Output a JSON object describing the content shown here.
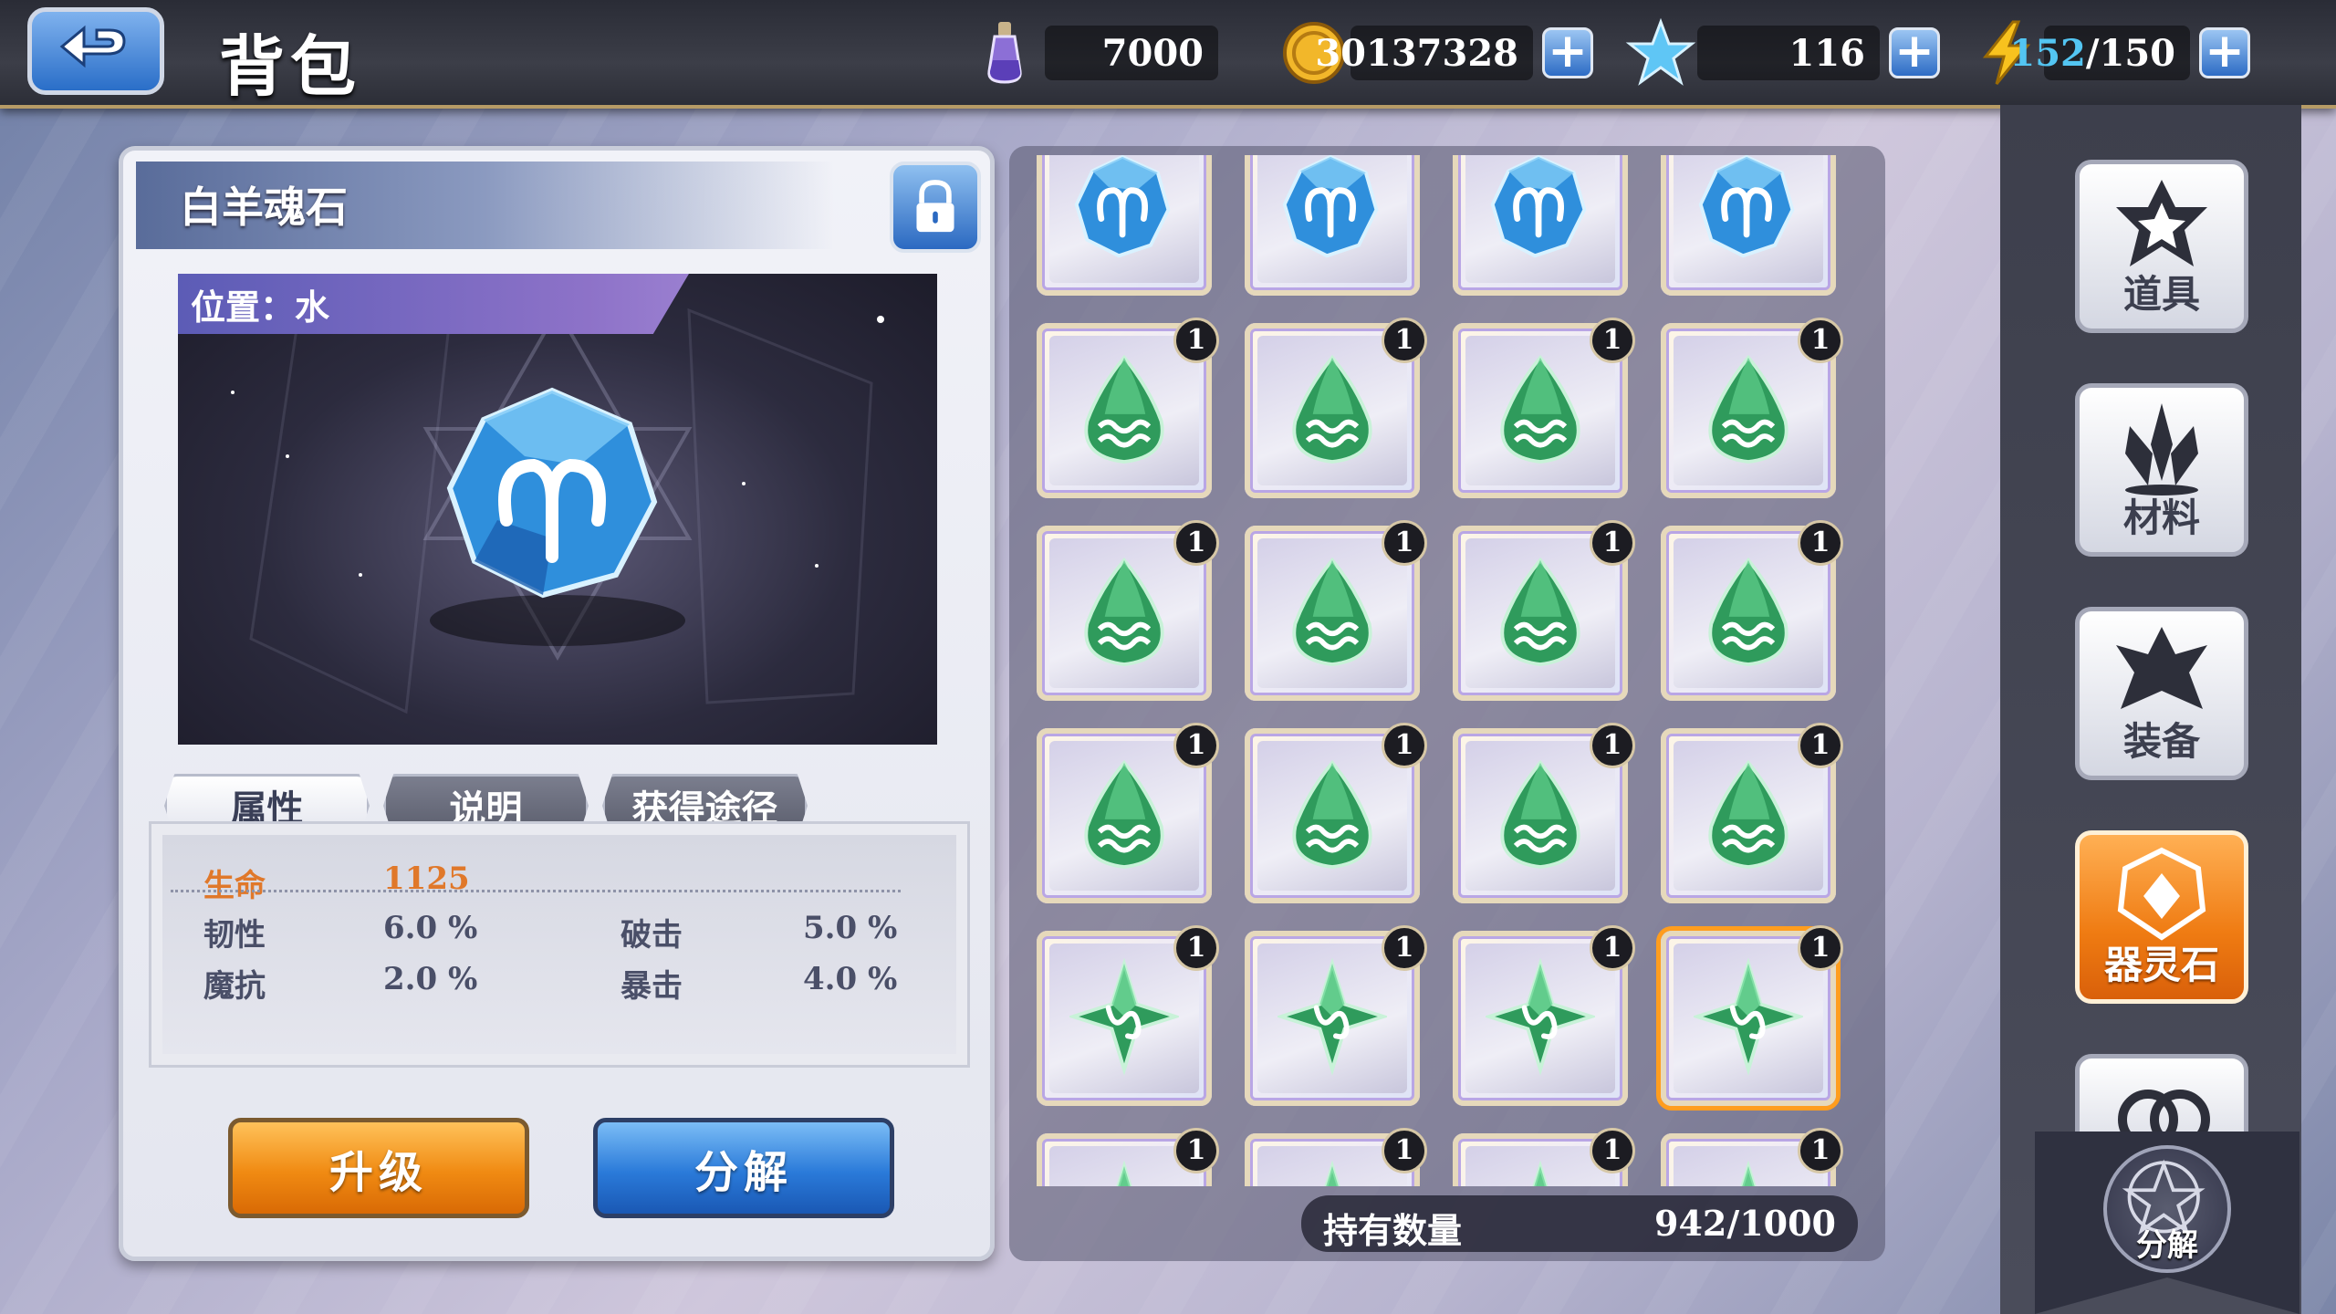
{
  "header": {
    "title": "背包",
    "resources": [
      {
        "name": "potion",
        "icon": "potion-icon",
        "value": "7000"
      },
      {
        "name": "gold",
        "icon": "coin-icon",
        "value": "30137328"
      },
      {
        "name": "star",
        "icon": "star-icon",
        "value": "116"
      },
      {
        "name": "stamina",
        "icon": "lightning-icon",
        "current": "152",
        "max": "/150"
      }
    ]
  },
  "detail": {
    "item_name": "白羊魂石",
    "position_label": "位置：水",
    "tabs": [
      "属性",
      "说明",
      "获得途径"
    ],
    "active_tab": 0,
    "stats": {
      "hp_label": "生命",
      "hp_value": "1125",
      "toughness_label": "韧性",
      "toughness_value": "6.0 %",
      "pierce_label": "破击",
      "pierce_value": "5.0 %",
      "magic_res_label": "魔抗",
      "magic_res_value": "2.0 %",
      "crit_label": "暴击",
      "crit_value": "4.0 %"
    },
    "upgrade_label": "升级",
    "decompose_label": "分解"
  },
  "inventory": {
    "count_label": "持有数量",
    "count_value": "942/1000",
    "rows": [
      {
        "gem": "aries-gem",
        "badges": [
          "",
          "",
          "",
          ""
        ]
      },
      {
        "gem": "aquarius-gem",
        "badges": [
          "1",
          "1",
          "1",
          "1"
        ]
      },
      {
        "gem": "aquarius-gem",
        "badges": [
          "1",
          "1",
          "1",
          "1"
        ]
      },
      {
        "gem": "aquarius-gem",
        "badges": [
          "1",
          "1",
          "1",
          "1"
        ]
      },
      {
        "gem": "capricorn-gem",
        "badges": [
          "1",
          "1",
          "1",
          "1"
        ]
      },
      {
        "gem": "capricorn-gem",
        "badges": [
          "1",
          "1",
          "1",
          "1"
        ]
      }
    ]
  },
  "sidebar": {
    "categories": [
      {
        "label": "道具",
        "icon": "items-icon"
      },
      {
        "label": "材料",
        "icon": "materials-icon"
      },
      {
        "label": "装备",
        "icon": "equipment-icon"
      },
      {
        "label": "器灵石",
        "icon": "spirit-stone-icon",
        "active": true
      },
      {
        "label": "",
        "icon": "ring-icon"
      }
    ],
    "decompose_label": "分解"
  },
  "colors": {
    "accent_orange": "#f08a12",
    "accent_blue": "#2a7ad9",
    "highlight": "#e0782a"
  }
}
